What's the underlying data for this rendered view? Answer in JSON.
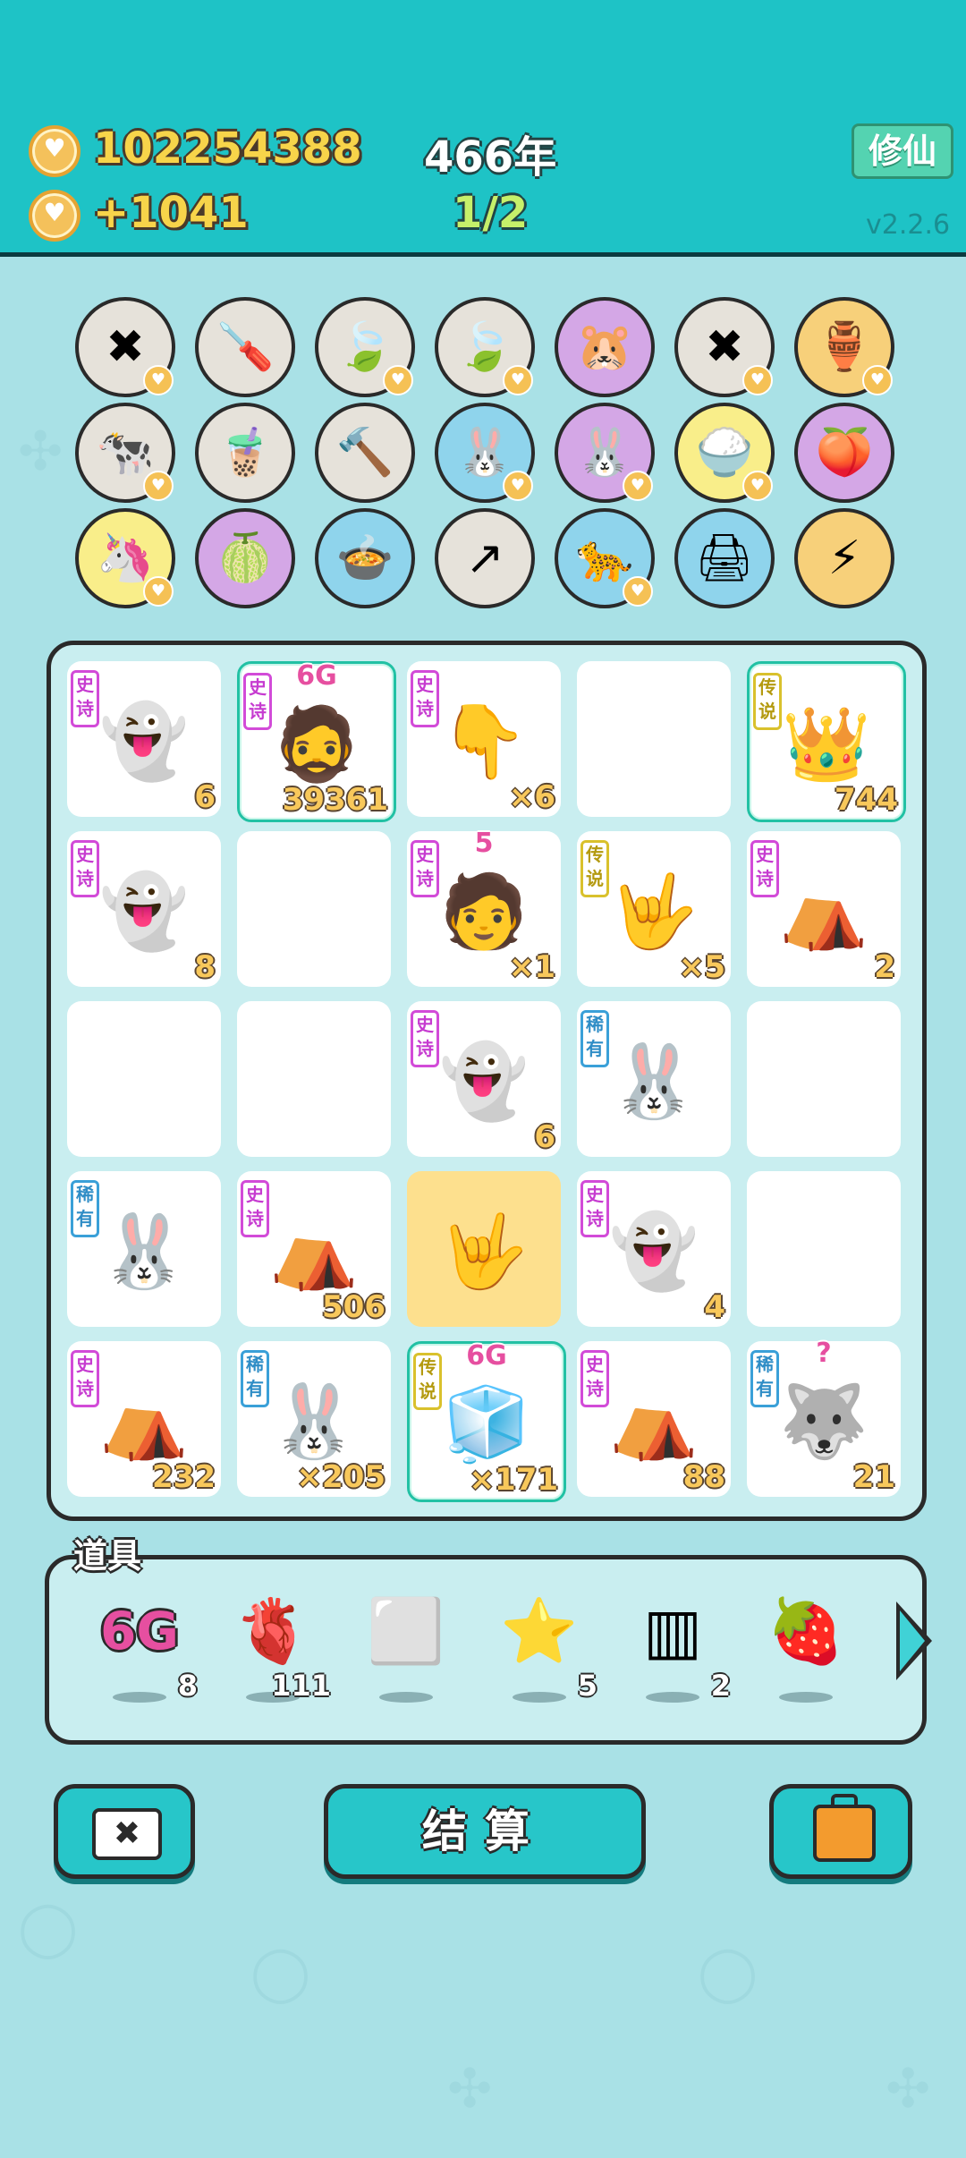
{
  "header": {
    "coins": "102254388",
    "income": "+1041",
    "year": "466年",
    "progress": "1/2",
    "xiuxian_label": "修仙",
    "version": "v2.2.6"
  },
  "top_items": [
    {
      "icon": "✖",
      "name": "close-tag-icon"
    },
    {
      "icon": "🪛",
      "name": "screwdriver-icon"
    },
    {
      "icon": "🍃",
      "name": "leaf-icon"
    },
    {
      "icon": "🍃",
      "name": "leaf-icon"
    },
    {
      "icon": "🐹",
      "name": "hamsters-icon"
    },
    {
      "icon": "✖",
      "name": "close-tag-icon"
    },
    {
      "icon": "🏺",
      "name": "vases-icon"
    },
    {
      "icon": "🐄",
      "name": "cows-icon"
    },
    {
      "icon": "🧋",
      "name": "boba-cup-icon"
    },
    {
      "icon": "🔨",
      "name": "hammer-icon"
    },
    {
      "icon": "🐰",
      "name": "rabbit-icon"
    },
    {
      "icon": "🐰",
      "name": "rabbit-icon"
    },
    {
      "icon": "🍚",
      "name": "rice-bowl-icon"
    },
    {
      "icon": "🍑",
      "name": "fruit-branch-icon"
    },
    {
      "icon": "🦄",
      "name": "unicorn-icon"
    },
    {
      "icon": "🍈",
      "name": "pomelo-icon"
    },
    {
      "icon": "🍲",
      "name": "pot-duck-icon"
    },
    {
      "icon": "↗",
      "name": "arrow-card-icon"
    },
    {
      "icon": "🐆",
      "name": "leopard-icon"
    },
    {
      "icon": "🖨",
      "name": "printer-icon"
    },
    {
      "icon": "⚡",
      "name": "lightning-icon"
    }
  ],
  "board": [
    {
      "tag": "史诗",
      "rarity": "epic",
      "art": "👻",
      "count": "6",
      "name": "ghost"
    },
    {
      "tag": "史诗",
      "rarity": "epic",
      "art": "🧔",
      "count": "39361",
      "name": "6g-king",
      "top_label": "6G",
      "highlight": true
    },
    {
      "tag": "史诗",
      "rarity": "epic",
      "art": "👇",
      "count": "×6",
      "name": "pointing-hand"
    },
    {
      "tag": "",
      "rarity": "",
      "art": "",
      "count": "",
      "name": "empty"
    },
    {
      "tag": "传说",
      "rarity": "legend",
      "art": "👑",
      "count": "744",
      "name": "old-king",
      "highlight": true
    },
    {
      "tag": "史诗",
      "rarity": "epic",
      "art": "👻",
      "count": "8",
      "name": "ghost"
    },
    {
      "tag": "",
      "rarity": "",
      "art": "",
      "count": "",
      "name": "empty"
    },
    {
      "tag": "史诗",
      "rarity": "epic",
      "art": "🧑",
      "count": "×1",
      "name": "green-hair-boy",
      "top_label": "5"
    },
    {
      "tag": "传说",
      "rarity": "legend",
      "art": "🤟",
      "count": "×5",
      "name": "yellow-hand"
    },
    {
      "tag": "史诗",
      "rarity": "epic",
      "art": "⛺",
      "count": "2",
      "name": "rabbit-tent"
    },
    {
      "tag": "",
      "rarity": "",
      "art": "",
      "count": "",
      "name": "empty"
    },
    {
      "tag": "",
      "rarity": "",
      "art": "",
      "count": "",
      "name": "empty"
    },
    {
      "tag": "史诗",
      "rarity": "epic",
      "art": "👻",
      "count": "6",
      "name": "ghost"
    },
    {
      "tag": "稀有",
      "rarity": "rare",
      "art": "🐰",
      "count": "",
      "name": "rabbit"
    },
    {
      "tag": "",
      "rarity": "",
      "art": "",
      "count": "",
      "name": "empty"
    },
    {
      "tag": "稀有",
      "rarity": "rare",
      "art": "🐰",
      "count": "",
      "name": "rabbit"
    },
    {
      "tag": "史诗",
      "rarity": "epic",
      "art": "⛺",
      "count": "506",
      "name": "rabbit-tent"
    },
    {
      "tag": "",
      "rarity": "",
      "art": "🤟",
      "count": "",
      "name": "selected-hand",
      "gold": true
    },
    {
      "tag": "史诗",
      "rarity": "epic",
      "art": "👻",
      "count": "4",
      "name": "ghost"
    },
    {
      "tag": "",
      "rarity": "",
      "art": "",
      "count": "",
      "name": "empty"
    },
    {
      "tag": "史诗",
      "rarity": "epic",
      "art": "⛺",
      "count": "232",
      "name": "rabbit-tent"
    },
    {
      "tag": "稀有",
      "rarity": "rare",
      "art": "🐰",
      "count": "×205",
      "name": "rabbit"
    },
    {
      "tag": "传说",
      "rarity": "legend",
      "art": "🧊",
      "count": "×171",
      "name": "fridge",
      "top_label": "6G",
      "highlight": true
    },
    {
      "tag": "史诗",
      "rarity": "epic",
      "art": "⛺",
      "count": "88",
      "name": "rabbit-tent"
    },
    {
      "tag": "稀有",
      "rarity": "rare",
      "art": "🐺",
      "count": "21",
      "name": "husky",
      "top_label": "?"
    }
  ],
  "props": {
    "label": "道具",
    "items": [
      {
        "icon": "6G",
        "count": "8",
        "name": "6g-prop-icon"
      },
      {
        "icon": "🫀",
        "count": "111",
        "name": "liver-prop-icon"
      },
      {
        "icon": "⬜",
        "count": "",
        "name": "frame-prop-icon"
      },
      {
        "icon": "⭐",
        "count": "5",
        "name": "star-prop-icon"
      },
      {
        "icon": "▥",
        "count": "2",
        "name": "slots-prop-icon"
      },
      {
        "icon": "🍓",
        "count": "",
        "name": "bayberry-prop-icon"
      }
    ]
  },
  "buttons": {
    "settle": "结算",
    "close_icon": "✖"
  },
  "colors": {
    "header_bg": "#1ec3c6",
    "page_bg": "#a9e1e6",
    "accent_gold": "#f7d44a",
    "button_teal": "#27c6c9"
  }
}
